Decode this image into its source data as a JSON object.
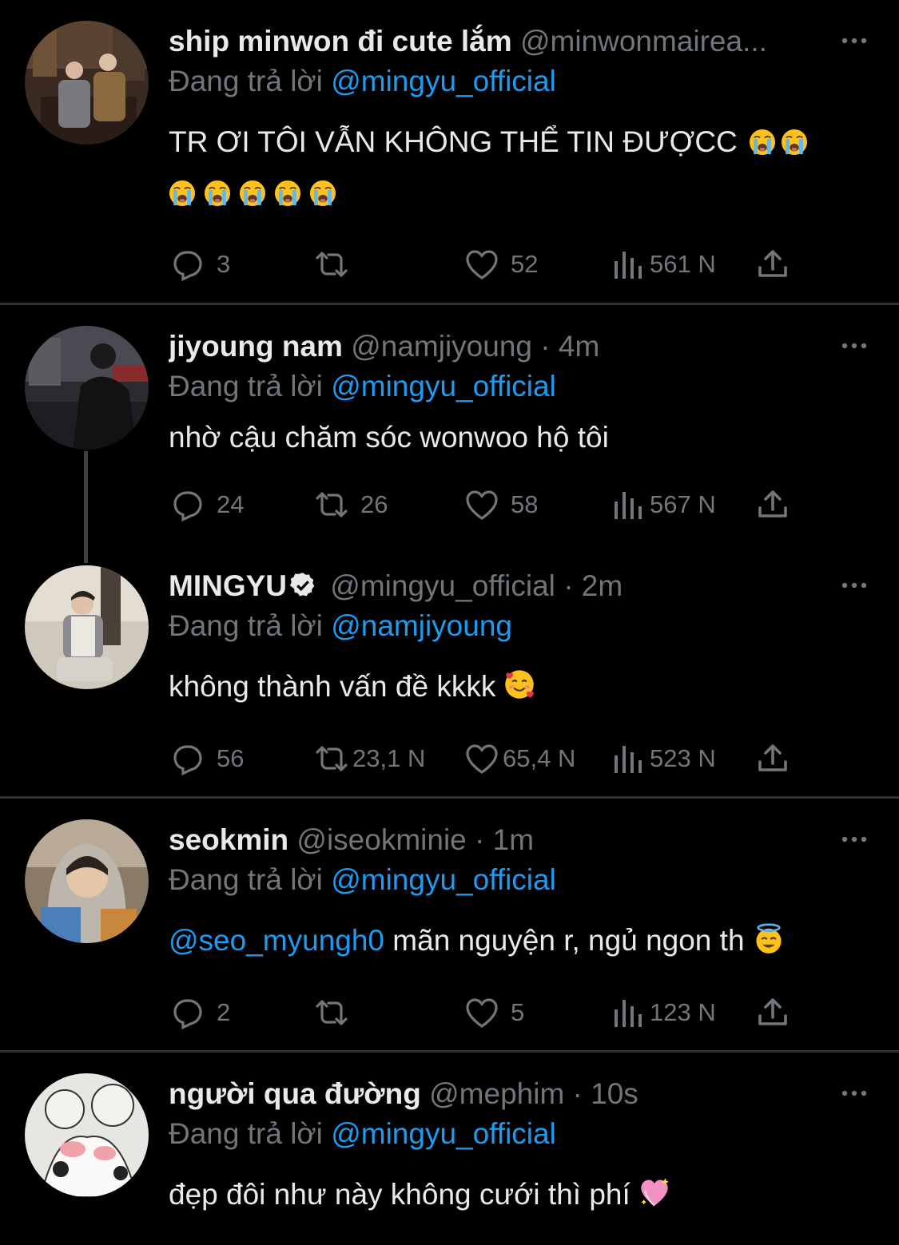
{
  "tweets": [
    {
      "name": "ship minwon đi cute lắm",
      "handle": "@minwonmairea...",
      "time": "",
      "reply_label": "Đang trả lời",
      "reply_to": "@mingyu_official",
      "text_line1": "TR ƠI TÔI VẪN KHÔNG THỂ TIN ĐƯỢCC",
      "emojis_line1": [
        "loudly-crying-emoji",
        "loudly-crying-emoji"
      ],
      "emojis_line2": [
        "loudly-crying-emoji",
        "loudly-crying-emoji",
        "loudly-crying-emoji",
        "loudly-crying-emoji",
        "loudly-crying-emoji"
      ],
      "replies": "3",
      "retweets": "",
      "likes": "52",
      "views": "561 N"
    },
    {
      "name": "jiyoung nam",
      "handle": "@namjiyoung",
      "dot": "·",
      "time": "4m",
      "reply_label": "Đang trả lời",
      "reply_to": "@mingyu_official",
      "text": "nhờ cậu chăm sóc wonwoo hộ tôi",
      "replies": "24",
      "retweets": "26",
      "likes": "58",
      "views": "567 N"
    },
    {
      "name": "MINGYU",
      "handle": "@mingyu_official",
      "dot": "·",
      "time": "2m",
      "reply_label": "Đang trả lời",
      "reply_to": "@namjiyoung",
      "text": "không thành vấn đề kkkk",
      "emoji": "smiling-face-with-hearts-emoji",
      "replies": "56",
      "retweets": "23,1 N",
      "likes": "65,4 N",
      "views": "523 N"
    },
    {
      "name": "seokmin",
      "handle": "@iseokminie",
      "dot": "·",
      "time": "1m",
      "reply_label": "Đang trả lời",
      "reply_to": "@mingyu_official",
      "text_mention": "@seo_myungh0",
      "text": "mãn nguyện r, ngủ ngon th",
      "emoji": "halo-face-emoji",
      "replies": "2",
      "retweets": "",
      "likes": "5",
      "views": "123 N"
    },
    {
      "name": "người qua đường",
      "handle": "@mephim",
      "dot": "·",
      "time": "10s",
      "reply_label": "Đang trả lời",
      "reply_to": "@mingyu_official",
      "text": "đẹp đôi như này không cưới thì phí",
      "emoji": "sparkling-heart-emoji"
    }
  ],
  "colors": {
    "background": "#000000",
    "text": "#e7e9ea",
    "muted": "#71767b",
    "link": "#1d9bf0",
    "separator": "#2f3336"
  }
}
